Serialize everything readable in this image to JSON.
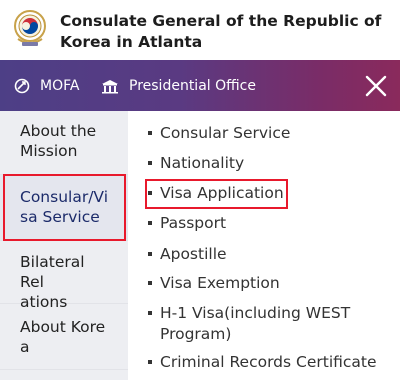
{
  "header": {
    "title": "Consulate General of the Republic of Korea in Atlanta",
    "emblem_icon": "korea-emblem-icon"
  },
  "navbar": {
    "mofa_label": "MOFA",
    "mofa_icon": "mofa-logo-icon",
    "presidential_label": "Presidential Office",
    "presidential_icon": "presidential-office-icon",
    "close_icon": "close-icon",
    "gradient_colors": [
      "#4d3f86",
      "#8a2a5c"
    ]
  },
  "left_menu": {
    "items": [
      {
        "label": "About the Mission",
        "line1": "About the",
        "line2": "Mission"
      },
      {
        "label": "Consular/Visa Service",
        "line1": "Consular/Vi",
        "line2": "sa Service",
        "active": true
      },
      {
        "label": "Bilateral Relations",
        "line1": "Bilateral Rel",
        "line2": "ations"
      },
      {
        "label": "About Korea",
        "line1": "About Kore",
        "line2": "a"
      }
    ]
  },
  "sub_menu": {
    "items": [
      {
        "label": "Consular Service"
      },
      {
        "label": "Nationality"
      },
      {
        "label": "Visa Application",
        "highlighted": true
      },
      {
        "label": "Passport"
      },
      {
        "label": "Apostille"
      },
      {
        "label": "Visa Exemption"
      },
      {
        "label": "H-1 Visa(including WEST",
        "line2": "Program)"
      },
      {
        "label": "Criminal Records Certificate"
      }
    ]
  },
  "colors": {
    "highlight_box": "#e8192c",
    "left_column_bg": "#edeef2"
  }
}
